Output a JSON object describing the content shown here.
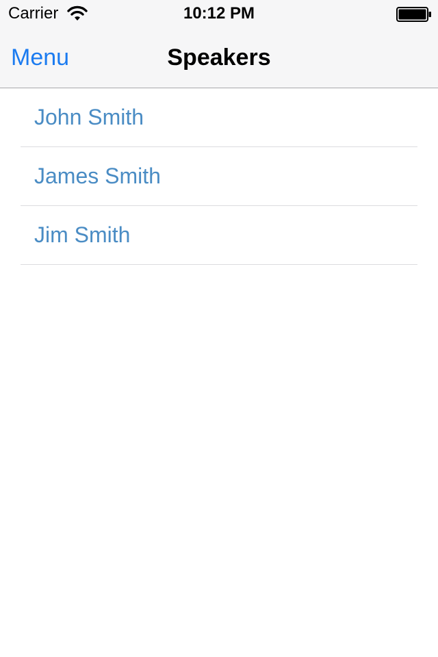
{
  "status_bar": {
    "carrier": "Carrier",
    "time": "10:12 PM",
    "wifi_icon": "wifi-icon",
    "battery_icon": "battery-icon"
  },
  "nav_bar": {
    "back_label": "Menu",
    "title": "Speakers"
  },
  "speakers": [
    {
      "name": "John Smith"
    },
    {
      "name": "James Smith"
    },
    {
      "name": "Jim Smith"
    }
  ],
  "colors": {
    "accent": "#1b7bf0",
    "list_text": "#4a8cc4",
    "bar_background": "#f6f6f7",
    "separator": "#dcdcdf"
  }
}
